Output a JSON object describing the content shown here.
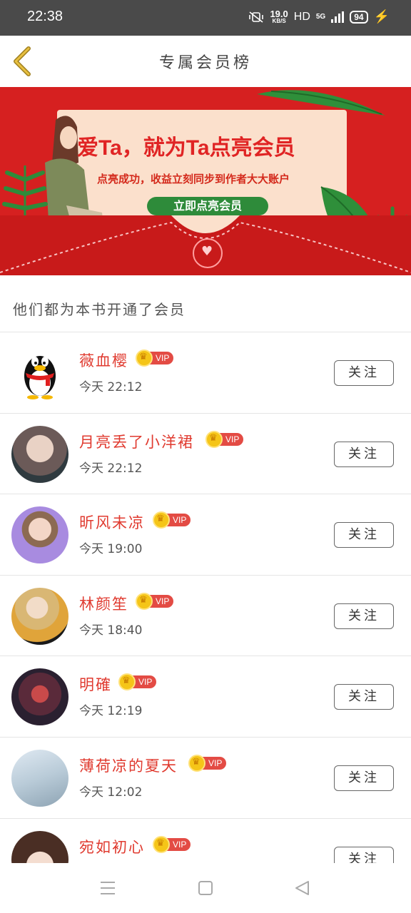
{
  "status_bar": {
    "time": "22:38",
    "net_speed": "19.0",
    "net_unit": "KB/S",
    "hd": "HD",
    "network": "5G",
    "battery": "94"
  },
  "header": {
    "title": "专属会员榜"
  },
  "banner": {
    "headline": "爱Ta，就为Ta点亮会员",
    "subtitle": "点亮成功，收益立刻同步到作者大大账户",
    "button_label": "立即点亮会员"
  },
  "section": {
    "title": "他们都为本书开通了会员"
  },
  "members": [
    {
      "name": "薇血樱",
      "badge": "VIP",
      "time": "今天 22:12",
      "follow_label": "关注"
    },
    {
      "name": "月亮丢了小洋裙",
      "badge": "VIP",
      "time": "今天 22:12",
      "follow_label": "关注"
    },
    {
      "name": "昕风未凉",
      "badge": "VIP",
      "time": "今天 19:00",
      "follow_label": "关注"
    },
    {
      "name": "林颜笙",
      "badge": "VIP",
      "time": "今天 18:40",
      "follow_label": "关注"
    },
    {
      "name": "明確",
      "badge": "VIP",
      "time": "今天 12:19",
      "follow_label": "关注"
    },
    {
      "name": "薄荷凉的夏天",
      "badge": "VIP",
      "time": "今天 12:02",
      "follow_label": "关注"
    },
    {
      "name": "宛如初心",
      "badge": "VIP",
      "time": "",
      "follow_label": "关注"
    }
  ],
  "colors": {
    "accent_red": "#e03a2f",
    "banner_red": "#d62020",
    "vip_gold": "#f5c518",
    "button_green": "#2e8b3a"
  }
}
